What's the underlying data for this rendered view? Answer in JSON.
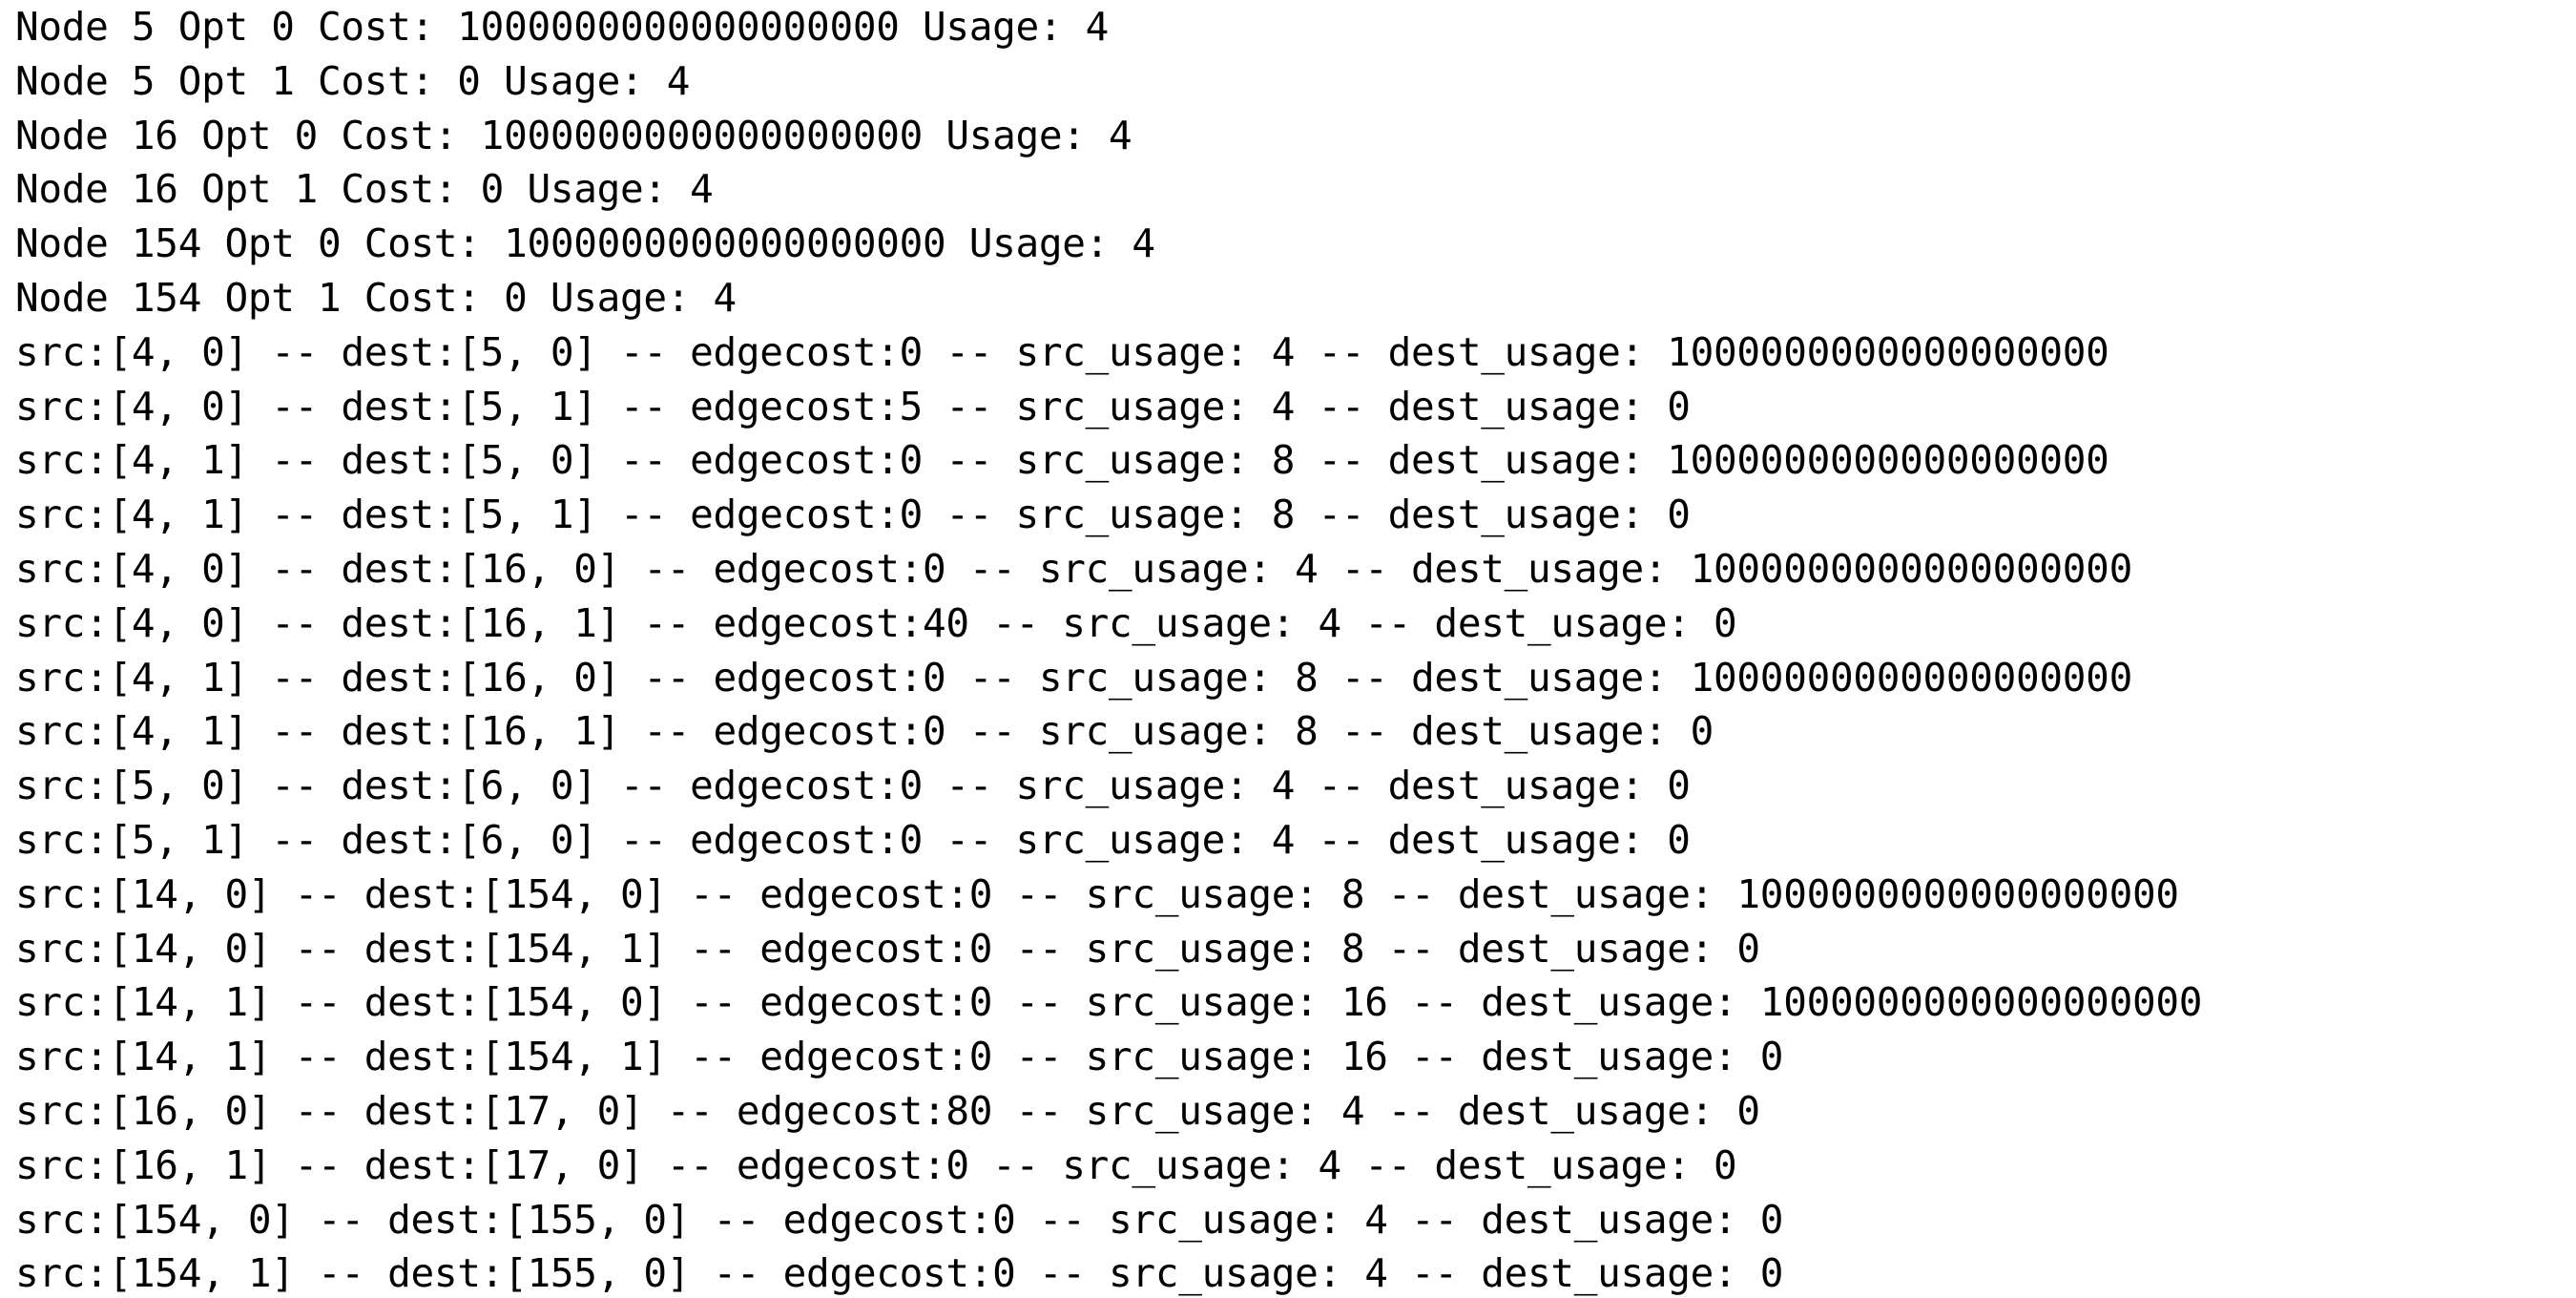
{
  "terminal": {
    "lines": [
      "Node 5 Opt 0 Cost: 1000000000000000000 Usage: 4",
      "Node 5 Opt 1 Cost: 0 Usage: 4",
      "Node 16 Opt 0 Cost: 1000000000000000000 Usage: 4",
      "Node 16 Opt 1 Cost: 0 Usage: 4",
      "Node 154 Opt 0 Cost: 1000000000000000000 Usage: 4",
      "Node 154 Opt 1 Cost: 0 Usage: 4",
      "src:[4, 0] -- dest:[5, 0] -- edgecost:0 -- src_usage: 4 -- dest_usage: 1000000000000000000",
      "src:[4, 0] -- dest:[5, 1] -- edgecost:5 -- src_usage: 4 -- dest_usage: 0",
      "src:[4, 1] -- dest:[5, 0] -- edgecost:0 -- src_usage: 8 -- dest_usage: 1000000000000000000",
      "src:[4, 1] -- dest:[5, 1] -- edgecost:0 -- src_usage: 8 -- dest_usage: 0",
      "src:[4, 0] -- dest:[16, 0] -- edgecost:0 -- src_usage: 4 -- dest_usage: 1000000000000000000",
      "src:[4, 0] -- dest:[16, 1] -- edgecost:40 -- src_usage: 4 -- dest_usage: 0",
      "src:[4, 1] -- dest:[16, 0] -- edgecost:0 -- src_usage: 8 -- dest_usage: 1000000000000000000",
      "src:[4, 1] -- dest:[16, 1] -- edgecost:0 -- src_usage: 8 -- dest_usage: 0",
      "src:[5, 0] -- dest:[6, 0] -- edgecost:0 -- src_usage: 4 -- dest_usage: 0",
      "src:[5, 1] -- dest:[6, 0] -- edgecost:0 -- src_usage: 4 -- dest_usage: 0",
      "src:[14, 0] -- dest:[154, 0] -- edgecost:0 -- src_usage: 8 -- dest_usage: 1000000000000000000",
      "src:[14, 0] -- dest:[154, 1] -- edgecost:0 -- src_usage: 8 -- dest_usage: 0",
      "src:[14, 1] -- dest:[154, 0] -- edgecost:0 -- src_usage: 16 -- dest_usage: 1000000000000000000",
      "src:[14, 1] -- dest:[154, 1] -- edgecost:0 -- src_usage: 16 -- dest_usage: 0",
      "src:[16, 0] -- dest:[17, 0] -- edgecost:80 -- src_usage: 4 -- dest_usage: 0",
      "src:[16, 1] -- dest:[17, 0] -- edgecost:0 -- src_usage: 4 -- dest_usage: 0",
      "src:[154, 0] -- dest:[155, 0] -- edgecost:0 -- src_usage: 4 -- dest_usage: 0",
      "src:[154, 1] -- dest:[155, 0] -- edgecost:0 -- src_usage: 4 -- dest_usage: 0"
    ]
  }
}
